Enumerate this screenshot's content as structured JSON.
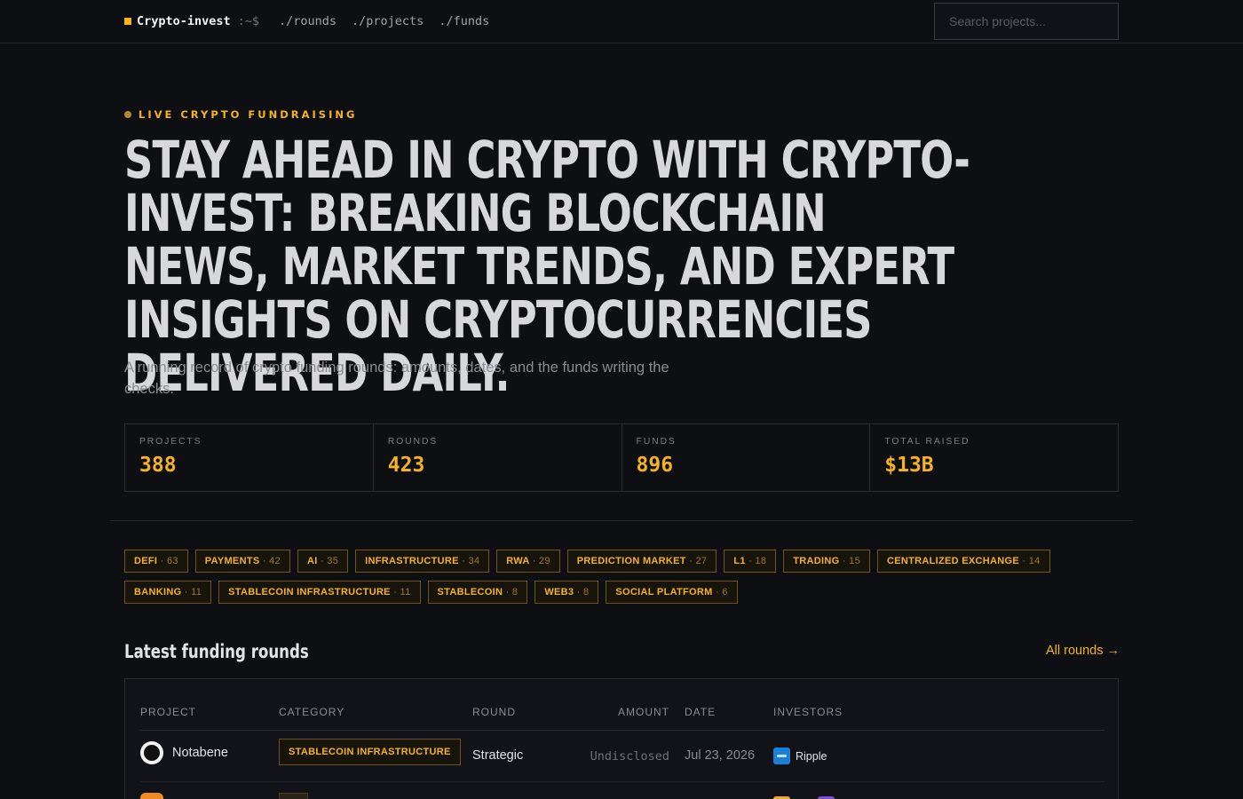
{
  "nav": {
    "brand": "Crypto-invest",
    "prompt": ":~$",
    "links": [
      "./rounds",
      "./projects",
      "./funds"
    ],
    "search_placeholder": "Search projects..."
  },
  "hero": {
    "eyebrow": "LIVE CRYPTO FUNDRAISING",
    "headline": "STAY AHEAD IN CRYPTO WITH CRYPTO-INVEST: BREAKING BLOCKCHAIN NEWS, MARKET TRENDS, AND EXPERT INSIGHTS ON CRYPTOCURRENCIES DELIVERED DAILY.",
    "subtitle": "A running record of crypto funding rounds: amounts, dates, and the funds writing the checks."
  },
  "stats": [
    {
      "label": "PROJECTS",
      "value": "388"
    },
    {
      "label": "ROUNDS",
      "value": "423"
    },
    {
      "label": "FUNDS",
      "value": "896"
    },
    {
      "label": "TOTAL RAISED",
      "value": "$13B"
    }
  ],
  "categories": [
    {
      "name": "DEFI",
      "count": "· 63"
    },
    {
      "name": "PAYMENTS",
      "count": "· 42"
    },
    {
      "name": "AI",
      "count": "· 35"
    },
    {
      "name": "INFRASTRUCTURE",
      "count": "· 34"
    },
    {
      "name": "RWA",
      "count": "· 29"
    },
    {
      "name": "PREDICTION MARKET",
      "count": "· 27"
    },
    {
      "name": "L1",
      "count": "· 18"
    },
    {
      "name": "TRADING",
      "count": "· 15"
    },
    {
      "name": "CENTRALIZED EXCHANGE",
      "count": "· 14"
    },
    {
      "name": "BANKING",
      "count": "· 11"
    },
    {
      "name": "STABLECOIN INFRASTRUCTURE",
      "count": "· 11"
    },
    {
      "name": "STABLECOIN",
      "count": "· 8"
    },
    {
      "name": "WEB3",
      "count": "· 8"
    },
    {
      "name": "SOCIAL PLATFORM",
      "count": "· 6"
    }
  ],
  "latest": {
    "title": "Latest funding rounds",
    "all_link": "All rounds →",
    "columns": [
      "PROJECT",
      "CATEGORY",
      "ROUND",
      "AMOUNT",
      "DATE",
      "INVESTORS"
    ],
    "rows": [
      {
        "project": "Notabene",
        "category": "STABLECOIN INFRASTRUCTURE",
        "round": "Strategic",
        "amount": "Undisclosed",
        "date": "Jul 23, 2026",
        "investor": "Ripple"
      }
    ]
  },
  "colors": {
    "background": "#0e0f13",
    "accent": "#f5b324",
    "text": "#e4e4e7",
    "muted": "#8a8b93"
  }
}
